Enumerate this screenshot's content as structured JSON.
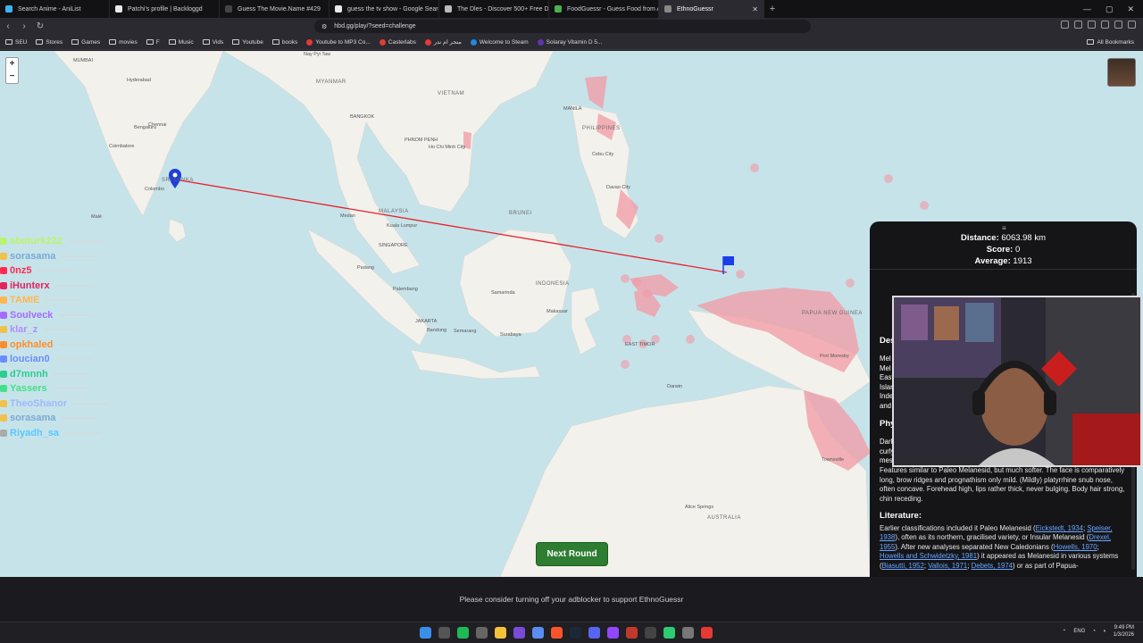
{
  "tabs": [
    {
      "title": "Search Anime - AniList",
      "color": "#3db4f2"
    },
    {
      "title": "Patchi's profile | Backloggd",
      "color": "#e8e8e8"
    },
    {
      "title": "Guess The Movie.Name #429",
      "color": "#444"
    },
    {
      "title": "guess the tv show - Google Search",
      "color": "#e8e8e8"
    },
    {
      "title": "The Dles - Discover 500+ Free Daily ...",
      "color": "#bbb"
    },
    {
      "title": "FoodGuessr - Guess Food from Arou...",
      "color": "#4caf50"
    },
    {
      "title": "EthnoGuessr",
      "color": "#888"
    }
  ],
  "newtab_label": "+",
  "address": {
    "url": "hbd.gg/play/?seed=challenge"
  },
  "bookmarks": [
    {
      "label": "SEU",
      "kind": "folder"
    },
    {
      "label": "Stores",
      "kind": "folder"
    },
    {
      "label": "Games",
      "kind": "folder"
    },
    {
      "label": "movies",
      "kind": "folder"
    },
    {
      "label": "F",
      "kind": "folder"
    },
    {
      "label": "Music",
      "kind": "folder"
    },
    {
      "label": "Vids",
      "kind": "folder"
    },
    {
      "label": "Youtube",
      "kind": "folder"
    },
    {
      "label": "books",
      "kind": "folder"
    },
    {
      "label": "Youtube to MP3 Co...",
      "kind": "site",
      "color": "#e53935"
    },
    {
      "label": "Casterlabs",
      "kind": "site",
      "color": "#e53935"
    },
    {
      "label": "متجر ام ندر",
      "kind": "site",
      "color": "#e53935"
    },
    {
      "label": "Welcome to Steam",
      "kind": "site",
      "color": "#1e88e5"
    },
    {
      "label": "Solaray Vitamin D 5...",
      "kind": "site",
      "color": "#5e35b1"
    }
  ],
  "all_bookmarks_label": "All Bookmarks",
  "map": {
    "zoom_in": "+",
    "zoom_out": "−",
    "labels": [
      {
        "text": "MUMBAI",
        "cls": "maplabel"
      },
      {
        "text": "Nay Pyi Taw",
        "cls": "maplabel"
      },
      {
        "text": "Hyderabad",
        "cls": "maplabel"
      },
      {
        "text": "MYANMAR",
        "cls": "maplabel country"
      },
      {
        "text": "VIETNAM",
        "cls": "maplabel country"
      },
      {
        "text": "Chennai",
        "cls": "maplabel"
      },
      {
        "text": "BANGKOK",
        "cls": "maplabel"
      },
      {
        "text": "Bengaluru",
        "cls": "maplabel"
      },
      {
        "text": "Coimbatore",
        "cls": "maplabel"
      },
      {
        "text": "PHNOM PENH",
        "cls": "maplabel"
      },
      {
        "text": "Ho Chi Minh City",
        "cls": "maplabel"
      },
      {
        "text": "Colombo",
        "cls": "maplabel"
      },
      {
        "text": "SRI LANKA",
        "cls": "maplabel country"
      },
      {
        "text": "MANILA",
        "cls": "maplabel"
      },
      {
        "text": "PHILIPPINES",
        "cls": "maplabel country"
      },
      {
        "text": "Cebu City",
        "cls": "maplabel"
      },
      {
        "text": "Davao City",
        "cls": "maplabel"
      },
      {
        "text": "Malé",
        "cls": "maplabel"
      },
      {
        "text": "MALAYSIA",
        "cls": "maplabel country"
      },
      {
        "text": "Medan",
        "cls": "maplabel"
      },
      {
        "text": "Kuala Lumpur",
        "cls": "maplabel"
      },
      {
        "text": "BRUNEI",
        "cls": "maplabel country"
      },
      {
        "text": "SINGAPORE",
        "cls": "maplabel"
      },
      {
        "text": "Padang",
        "cls": "maplabel"
      },
      {
        "text": "Palembang",
        "cls": "maplabel"
      },
      {
        "text": "Samarinda",
        "cls": "maplabel"
      },
      {
        "text": "INDONESIA",
        "cls": "maplabel country"
      },
      {
        "text": "Makassar",
        "cls": "maplabel"
      },
      {
        "text": "JAKARTA",
        "cls": "maplabel"
      },
      {
        "text": "Bandung",
        "cls": "maplabel"
      },
      {
        "text": "Semarang",
        "cls": "maplabel"
      },
      {
        "text": "Surabaya",
        "cls": "maplabel"
      },
      {
        "text": "EAST TIMOR",
        "cls": "maplabel"
      },
      {
        "text": "PAPUA NEW GUINEA",
        "cls": "maplabel country"
      },
      {
        "text": "Port Moresby",
        "cls": "maplabel"
      },
      {
        "text": "Darwin",
        "cls": "maplabel"
      },
      {
        "text": "Townsville",
        "cls": "maplabel"
      },
      {
        "text": "Alice Springs",
        "cls": "maplabel"
      },
      {
        "text": "AUSTRALIA",
        "cls": "maplabel country"
      }
    ]
  },
  "chat": [
    {
      "user": "abuturk222",
      "color": "#b9f56a",
      "badge": "#b9f56a"
    },
    {
      "user": "sorasama",
      "color": "#7aa9d6",
      "badge": "#f0c14b"
    },
    {
      "user": "0nz5",
      "color": "#ff2a50",
      "badge": "#ff2a50"
    },
    {
      "user": "iHunterx",
      "color": "#e0245e",
      "badge": "#e0245e"
    },
    {
      "user": "TAMIE",
      "color": "#ffb74d",
      "badge": "#ffb74d"
    },
    {
      "user": "Soulveck",
      "color": "#a56bff",
      "badge": "#a56bff"
    },
    {
      "user": "klar_z",
      "color": "#b38cff",
      "badge": "#f0c14b"
    },
    {
      "user": "opkhaled",
      "color": "#ff8c2a",
      "badge": "#ff8c2a"
    },
    {
      "user": "loucian0",
      "color": "#6b8cff",
      "badge": "#6b8cff"
    },
    {
      "user": "d7mnnh",
      "color": "#2ecc8f",
      "badge": "#2ecc8f"
    },
    {
      "user": "Yassers",
      "color": "#43e08a",
      "badge": "#43e08a"
    },
    {
      "user": "TheoShanor",
      "color": "#9fb8ff",
      "badge": "#f0c14b"
    },
    {
      "user": "sorasama",
      "color": "#7aa9d6",
      "badge": "#f0c14b"
    },
    {
      "user": "Riyadh_sa",
      "color": "#59c7ff",
      "badge": "#aaaaaa"
    }
  ],
  "panel": {
    "handle": "≡",
    "distance_label": "Distance:",
    "distance_value": "6063.98 km",
    "score_label": "Score:",
    "score_value": "0",
    "average_label": "Average:",
    "average_value": "1913",
    "desc_heading": "Des",
    "desc_frag": [
      "Mel",
      "Mel",
      "East",
      "Islar",
      "Inde",
      "and"
    ],
    "phys_heading": "Phy",
    "phys_frag": [
      "Dark",
      "curly",
      "mes"
    ],
    "physical_text": "Features similar to Paleo Melanesid, but much softer. The face is comparatively long, brow ridges and prognathism only mild. (Mildly) platyrrhine snub nose, often concave. Forehead high, lips rather thick, never bulging. Body hair strong, chin receding.",
    "literature_heading": "Literature:",
    "lit_1": "Earlier classifications included it Paleo Melanesid (",
    "lit_link_1": "Eickstedt, 1934",
    "lit_2": "; ",
    "lit_link_2": "Speiser, 1938",
    "lit_3": "), often as its northern, gracilised variety, or Insular Melanesid (",
    "lit_link_3": "Drexel, 1955",
    "lit_4": "). After new analyses separated New Caledonians (",
    "lit_link_4": "Howells, 1970",
    "lit_5": "; ",
    "lit_link_5": "Howells and Schwidetzky, 1981",
    "lit_6": ") it appeared as Melanesid in various systems (",
    "lit_link_6": "Biasutti, 1952",
    "lit_7": "; ",
    "lit_link_7": "Vallois, 1971",
    "lit_8": "; ",
    "lit_link_8": "Debets, 1974",
    "lit_9": ") or as part of Papua-"
  },
  "next_round_label": "Next Round",
  "footer_text": "Please consider turning off your adblocker to support EthnoGuessr",
  "tray": {
    "lang": "ENG",
    "time": "9:49 PM",
    "date": "1/3/2026"
  },
  "colors": {
    "guess_line": "#e8202a",
    "region_fill": "#f29aa5",
    "pin": "#1f3fd6",
    "flag": "#1a3ee8"
  }
}
